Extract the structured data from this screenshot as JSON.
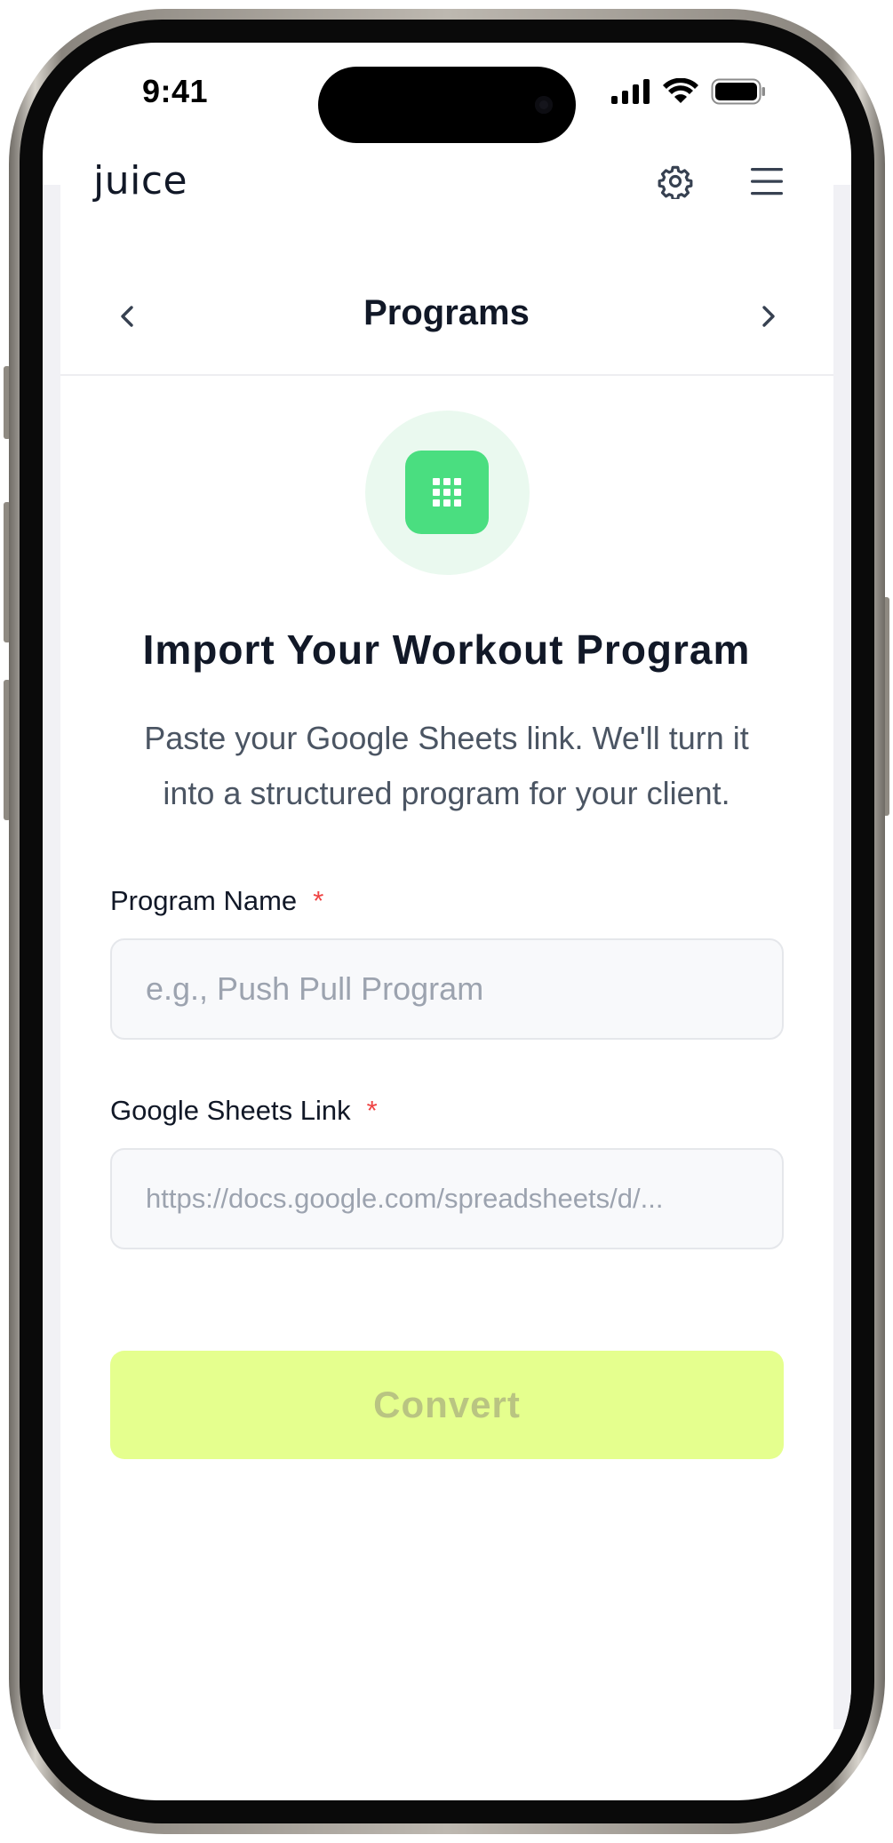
{
  "status_bar": {
    "time": "9:41"
  },
  "app": {
    "logo": "juice"
  },
  "nav": {
    "title": "Programs"
  },
  "hero": {
    "heading": "Import Your Workout Program",
    "subtext": "Paste your Google Sheets link. We'll turn it into a structured program for your client."
  },
  "form": {
    "program_name": {
      "label": "Program Name",
      "required_mark": "*",
      "placeholder": "e.g., Push Pull Program",
      "value": ""
    },
    "sheets_link": {
      "label": "Google Sheets Link",
      "required_mark": "*",
      "placeholder": "https://docs.google.com/spreadsheets/d/...",
      "value": ""
    },
    "submit_label": "Convert"
  },
  "icons": {
    "settings": "gear-icon",
    "menu": "hamburger-menu-icon",
    "prev": "chevron-left-icon",
    "next": "chevron-right-icon",
    "hero": "spreadsheet-grid-icon"
  },
  "colors": {
    "accent_green": "#4ade80",
    "convert_button": "#e5ff8e",
    "required": "#ef4444"
  }
}
